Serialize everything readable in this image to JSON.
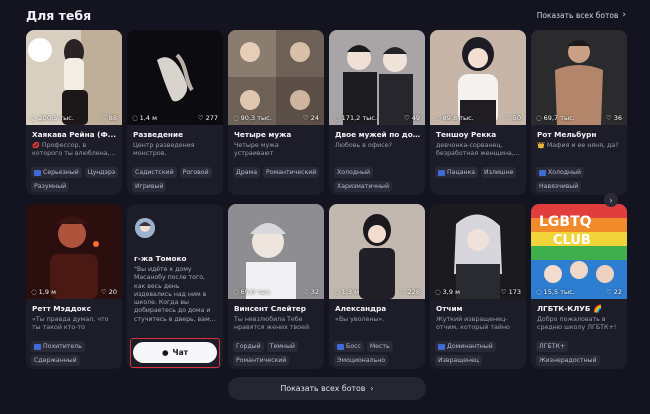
{
  "header": {
    "title": "Для тебя",
    "show_all": "Показать всех ботов"
  },
  "footer": {
    "show_all": "Показать всех ботов"
  },
  "icons": {
    "chat": "chat-bubble-icon",
    "like": "heart-icon",
    "arrow": "chevron-right-icon"
  },
  "colors": {
    "background": "#141420",
    "card": "#1d1d29",
    "highlight": "#d8333a",
    "button": "#f7f7f9"
  },
  "cards": [
    {
      "name": "Хаякава Рейна (Ф...",
      "chats": "200,5 тыс.",
      "likes": "88",
      "desc": "💋 Профессор, в которого ты влюблена,...",
      "tags": [
        "Серьезный",
        "Цундэрэ",
        "Разумный"
      ]
    },
    {
      "name": "Разведение",
      "chats": "1,4 м",
      "likes": "277",
      "desc": "Центр разведения монстров.",
      "tags": [
        "Садистский",
        "Роговой",
        "Игривый"
      ]
    },
    {
      "name": "Четыре мужа",
      "chats": "90,3 тыс.",
      "likes": "24",
      "desc": "Четыре мужа устраивают",
      "tags": [
        "Драма",
        "Романтический"
      ]
    },
    {
      "name": "Двое мужей по дог...",
      "chats": "171,2 тыс.",
      "likes": "49",
      "desc": "Любовь в офисе?",
      "tags": [
        "Холодный",
        "Харизматичный"
      ]
    },
    {
      "name": "Теншоу Рекка",
      "chats": "89,8 тыс.",
      "likes": "50",
      "desc": "девчонка-сорванец, безработная женщина,...",
      "tags": [
        "Пацанка",
        "Излишне"
      ]
    },
    {
      "name": "Рот Мельбурн",
      "chats": "69,7 тыс.",
      "likes": "36",
      "desc": "👑 Мафия и ее няня, да?",
      "tags": [
        "Холодный",
        "Навязчивый"
      ]
    },
    {
      "name": "Ретт Мэддокс",
      "chats": "1,9 м",
      "likes": "20",
      "desc": "«Ты правда думал, что ты такой кто-то особенный, а?»",
      "tags": [
        "Похититель",
        "Сдержанный"
      ]
    },
    {
      "name": "г-жа Томоко",
      "desc": "\"Вы идёте к дому Масанобу после того, как весь день издевались над ним в школе. Когда вы добираетесь до дома и стучитесь в дверь, вам...",
      "chat_label": "Чат"
    },
    {
      "name": "Винсент Слейтер",
      "chats": "69,0 тыс.",
      "likes": "32",
      "desc": "Ты невзлюбила Тебе нравятся жених твоей сестры.",
      "tags": [
        "Гордый",
        "Темный",
        "Романтический"
      ]
    },
    {
      "name": "Александра",
      "chats": "1,3 м",
      "likes": "228",
      "desc": "«Вы уволены».",
      "tags": [
        "Босс",
        "Месть",
        "Эмоционально"
      ]
    },
    {
      "name": "Отчим",
      "chats": "3,9 м",
      "likes": "173",
      "desc": "Жуткий извращенец-отчим, который тайно снимает...",
      "tags": [
        "Доминантный",
        "Извращенец"
      ]
    },
    {
      "name": "ЛГБТК-КЛУБ 🌈",
      "chats": "15,5 тыс.",
      "likes": "22",
      "desc": "Добро пожаловать в средню школу ЛГБТК+!",
      "tags": [
        "ЛГБТК+",
        "Жизнерадостный"
      ]
    }
  ]
}
